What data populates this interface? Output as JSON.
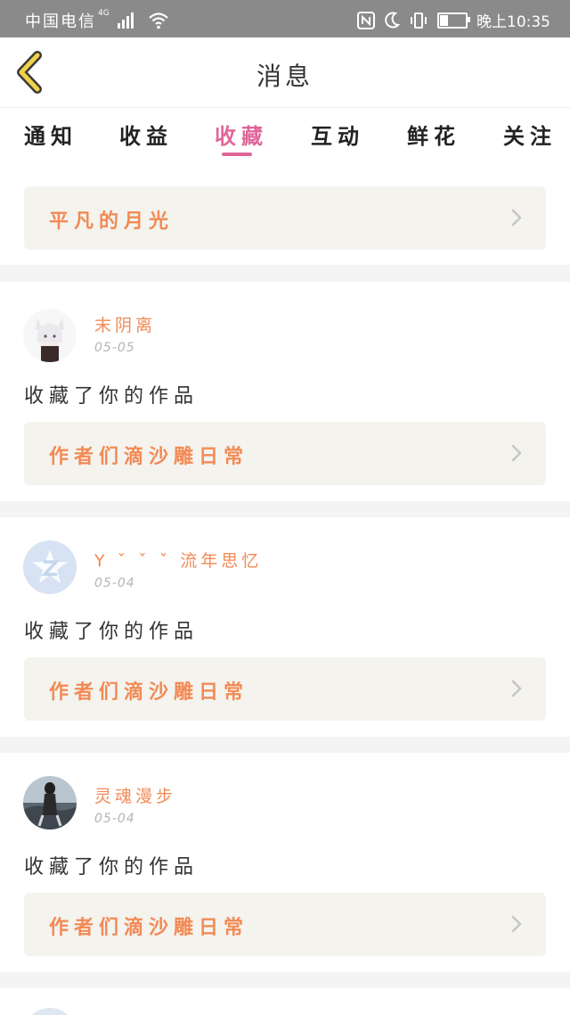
{
  "status_bar": {
    "carrier": "中国电信",
    "network": "4G",
    "time": "晚上10:35",
    "battery_level": 0.3
  },
  "header": {
    "title": "消息"
  },
  "tabs": [
    {
      "label": "通知",
      "active": false
    },
    {
      "label": "收益",
      "active": false
    },
    {
      "label": "收藏",
      "active": true
    },
    {
      "label": "互动",
      "active": false
    },
    {
      "label": "鲜花",
      "active": false
    },
    {
      "label": "关注",
      "active": false
    }
  ],
  "feed": {
    "partial_top_item": {
      "work_title": "平凡的月光"
    },
    "items": [
      {
        "username": "末阴离",
        "date": "05-05",
        "action": "收藏了你的作品",
        "work_title": "作者们滴沙雕日常"
      },
      {
        "username": "Y ˇ ˇ ˇ 流年思忆",
        "date": "05-04",
        "action": "收藏了你的作品",
        "work_title": "作者们滴沙雕日常"
      },
      {
        "username": "灵魂漫步",
        "date": "05-04",
        "action": "收藏了你的作品",
        "work_title": "作者们滴沙雕日常"
      }
    ]
  },
  "colors": {
    "accent_pink": "#e0669a",
    "username_orange": "#f28a55",
    "card_bg": "#f4f3ee",
    "back_arrow": "#f0d24a"
  },
  "icons": {
    "back": "back-arrow-icon",
    "chevron": "chevron-right-icon",
    "nfc": "nfc-icon",
    "moon": "moon-icon",
    "vibrate": "vibrate-icon",
    "wifi": "wifi-icon",
    "signal": "signal-icon",
    "battery": "battery-icon"
  }
}
